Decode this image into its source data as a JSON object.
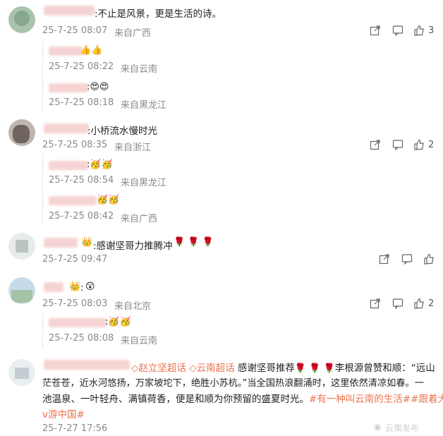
{
  "comments": [
    {
      "text": ":不止是风景，更是生活的诗。",
      "time": "25-7-25 08:07",
      "location": "来自广西",
      "likes": "3",
      "replies": [
        {
          "time": "25-7-25 08:22",
          "location": "来自云南"
        },
        {
          "time": "25-7-25 08:18",
          "location": "来自黑龙江"
        }
      ]
    },
    {
      "text": ":小桥流水慢时光",
      "time": "25-7-25 08:35",
      "location": "来自浙江",
      "likes": "2",
      "replies": [
        {
          "time": "25-7-25 08:54",
          "location": "来自黑龙江"
        },
        {
          "time": "25-7-25 08:42",
          "location": "来自广西"
        }
      ]
    },
    {
      "text": ":感谢坚哥力推腾冲",
      "time": "25-7-25 09:47",
      "location": ""
    },
    {
      "text": ":",
      "time": "25-7-25 08:03",
      "location": "来自北京",
      "likes": "2",
      "replies": [
        {
          "time": "25-7-25 08:08",
          "location": "来自云南"
        }
      ]
    },
    {
      "topic1": "赵立坚超话",
      "topic2": "云南超话",
      "line1_rest": "感谢坚哥推荐",
      "line1_tail": "李根源曾赞和顺：“远山",
      "line2": "茫苍苍，近水河悠扬，万家坡坨下，绝胜小苏杭。”当全国热浪翻涌时，这里依然清凉如春。一",
      "line3_start": "池温泉、一叶轻舟、满镇荷香，便是和顺为你预留的盛夏时光。",
      "hashtag1": "#有一种叫云南的生活#",
      "hashtag2": "#跟着大",
      "line4_tag": "v游中国#",
      "time": "25-7-27 17:56"
    }
  ],
  "watermark": "云南发布",
  "icons": {
    "share": "share-icon",
    "comment": "comment-icon",
    "like": "like-icon"
  }
}
